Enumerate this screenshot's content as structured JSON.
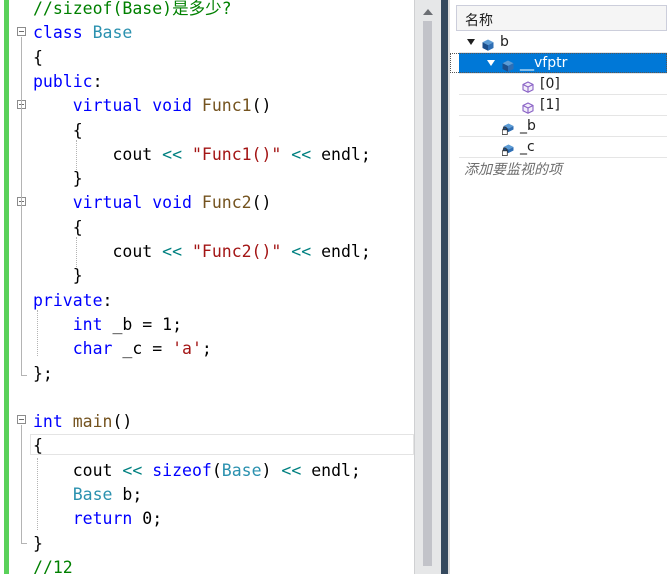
{
  "editor": {
    "lines": [
      [
        {
          "t": "//sizeof(Base)是多少?",
          "c": "cm"
        }
      ],
      [
        {
          "t": "class",
          "c": "kw"
        },
        {
          "t": " ",
          "c": "plain"
        },
        {
          "t": "Base",
          "c": "ty"
        }
      ],
      [
        {
          "t": "{",
          "c": "plain"
        }
      ],
      [
        {
          "t": "public",
          "c": "kw"
        },
        {
          "t": ":",
          "c": "plain"
        }
      ],
      [
        {
          "t": "    ",
          "c": "plain"
        },
        {
          "t": "virtual",
          "c": "kw"
        },
        {
          "t": " ",
          "c": "plain"
        },
        {
          "t": "void",
          "c": "kw"
        },
        {
          "t": " ",
          "c": "plain"
        },
        {
          "t": "Func1",
          "c": "fn"
        },
        {
          "t": "()",
          "c": "plain"
        }
      ],
      [
        {
          "t": "    {",
          "c": "plain"
        }
      ],
      [
        {
          "t": "        cout ",
          "c": "plain"
        },
        {
          "t": "<<",
          "c": "op"
        },
        {
          "t": " ",
          "c": "plain"
        },
        {
          "t": "\"Func1()\"",
          "c": "str"
        },
        {
          "t": " ",
          "c": "plain"
        },
        {
          "t": "<<",
          "c": "op"
        },
        {
          "t": " endl;",
          "c": "plain"
        }
      ],
      [
        {
          "t": "    }",
          "c": "plain"
        }
      ],
      [
        {
          "t": "    ",
          "c": "plain"
        },
        {
          "t": "virtual",
          "c": "kw"
        },
        {
          "t": " ",
          "c": "plain"
        },
        {
          "t": "void",
          "c": "kw"
        },
        {
          "t": " ",
          "c": "plain"
        },
        {
          "t": "Func2",
          "c": "fn"
        },
        {
          "t": "()",
          "c": "plain"
        }
      ],
      [
        {
          "t": "    {",
          "c": "plain"
        }
      ],
      [
        {
          "t": "        cout ",
          "c": "plain"
        },
        {
          "t": "<<",
          "c": "op"
        },
        {
          "t": " ",
          "c": "plain"
        },
        {
          "t": "\"Func2()\"",
          "c": "str"
        },
        {
          "t": " ",
          "c": "plain"
        },
        {
          "t": "<<",
          "c": "op"
        },
        {
          "t": " endl;",
          "c": "plain"
        }
      ],
      [
        {
          "t": "    }",
          "c": "plain"
        }
      ],
      [
        {
          "t": "private",
          "c": "kw"
        },
        {
          "t": ":",
          "c": "plain"
        }
      ],
      [
        {
          "t": "    ",
          "c": "plain"
        },
        {
          "t": "int",
          "c": "kw"
        },
        {
          "t": " _b = 1;",
          "c": "plain"
        }
      ],
      [
        {
          "t": "    ",
          "c": "plain"
        },
        {
          "t": "char",
          "c": "kw"
        },
        {
          "t": " _c = ",
          "c": "plain"
        },
        {
          "t": "'a'",
          "c": "str"
        },
        {
          "t": ";",
          "c": "plain"
        }
      ],
      [
        {
          "t": "};",
          "c": "plain"
        }
      ],
      [],
      [
        {
          "t": "int",
          "c": "kw"
        },
        {
          "t": " ",
          "c": "plain"
        },
        {
          "t": "main",
          "c": "fn"
        },
        {
          "t": "()",
          "c": "plain"
        }
      ],
      [
        {
          "t": "{",
          "c": "plain"
        }
      ],
      [
        {
          "t": "    cout ",
          "c": "plain"
        },
        {
          "t": "<<",
          "c": "op"
        },
        {
          "t": " ",
          "c": "plain"
        },
        {
          "t": "sizeof",
          "c": "kw"
        },
        {
          "t": "(",
          "c": "plain"
        },
        {
          "t": "Base",
          "c": "ty"
        },
        {
          "t": ") ",
          "c": "plain"
        },
        {
          "t": "<<",
          "c": "op"
        },
        {
          "t": " endl;",
          "c": "plain"
        }
      ],
      [
        {
          "t": "    ",
          "c": "plain"
        },
        {
          "t": "Base",
          "c": "ty"
        },
        {
          "t": " b;",
          "c": "plain"
        }
      ],
      [
        {
          "t": "    ",
          "c": "plain"
        },
        {
          "t": "return",
          "c": "kw"
        },
        {
          "t": " 0;",
          "c": "plain"
        }
      ],
      [
        {
          "t": "}",
          "c": "plain"
        }
      ],
      [
        {
          "t": "//12",
          "c": "cm"
        }
      ]
    ]
  },
  "colors": {
    "keyword": "#0000ff",
    "type": "#2b91af",
    "function": "#74531f",
    "string": "#a31515",
    "comment": "#008000",
    "operator": "#008080",
    "change_bar": "#5ad15a",
    "selection": "#0078d7"
  },
  "watch": {
    "header": "名称",
    "add_placeholder": "添加要监视的项",
    "items": [
      {
        "name": "b",
        "level": 0,
        "expander": "expanded",
        "icon": "object-icon",
        "selected": false
      },
      {
        "name": "__vfptr",
        "level": 1,
        "expander": "expanded",
        "icon": "object-icon",
        "selected": true
      },
      {
        "name": "[0]",
        "level": 2,
        "expander": "none",
        "icon": "cube-icon",
        "selected": false
      },
      {
        "name": "[1]",
        "level": 2,
        "expander": "none",
        "icon": "cube-icon",
        "selected": false
      },
      {
        "name": "_b",
        "level": 1,
        "expander": "none",
        "icon": "private-field-icon",
        "selected": false
      },
      {
        "name": "_c",
        "level": 1,
        "expander": "none",
        "icon": "private-field-icon",
        "selected": false
      }
    ]
  }
}
